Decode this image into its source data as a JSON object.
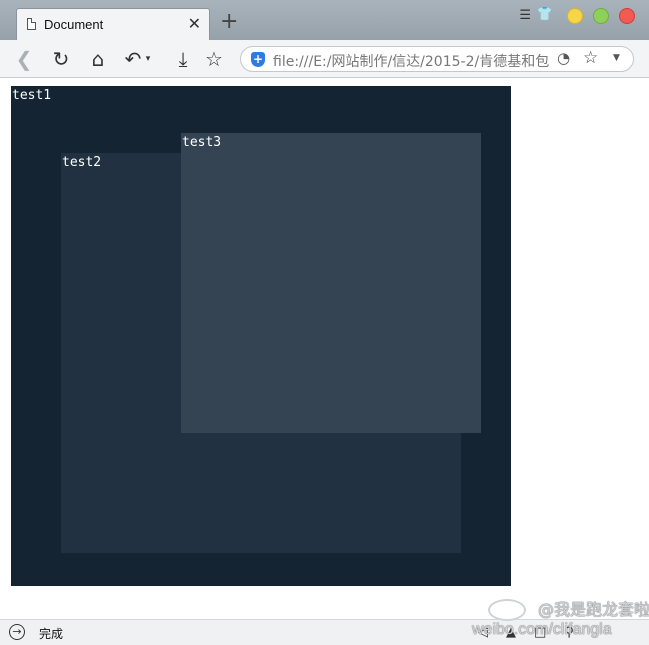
{
  "browser": {
    "tab": {
      "title": "Document"
    },
    "address": {
      "url": "file:///E:/网站制作/信达/2015-2/肯德基和包"
    },
    "icons": {
      "tab_page": "document-icon",
      "tab_close": "close-icon",
      "new_tab": "plus-icon",
      "menu": "menu-icon",
      "skin": "shirt-icon",
      "back": "back-arrow-icon",
      "reload": "reload-icon",
      "home": "home-icon",
      "undo": "undo-icon",
      "download": "download-icon",
      "bookmark": "star-icon",
      "security": "shield-icon",
      "speed": "speedometer-icon"
    }
  },
  "page": {
    "boxes": [
      {
        "label": "test1",
        "color": "#142433"
      },
      {
        "label": "test2",
        "color": "#223141"
      },
      {
        "label": "test3",
        "color": "#344453"
      }
    ]
  },
  "status": {
    "text": "完成"
  },
  "watermark": {
    "line1": "@我是跑龙套啦",
    "line2": "weibo.com/clifangla"
  }
}
